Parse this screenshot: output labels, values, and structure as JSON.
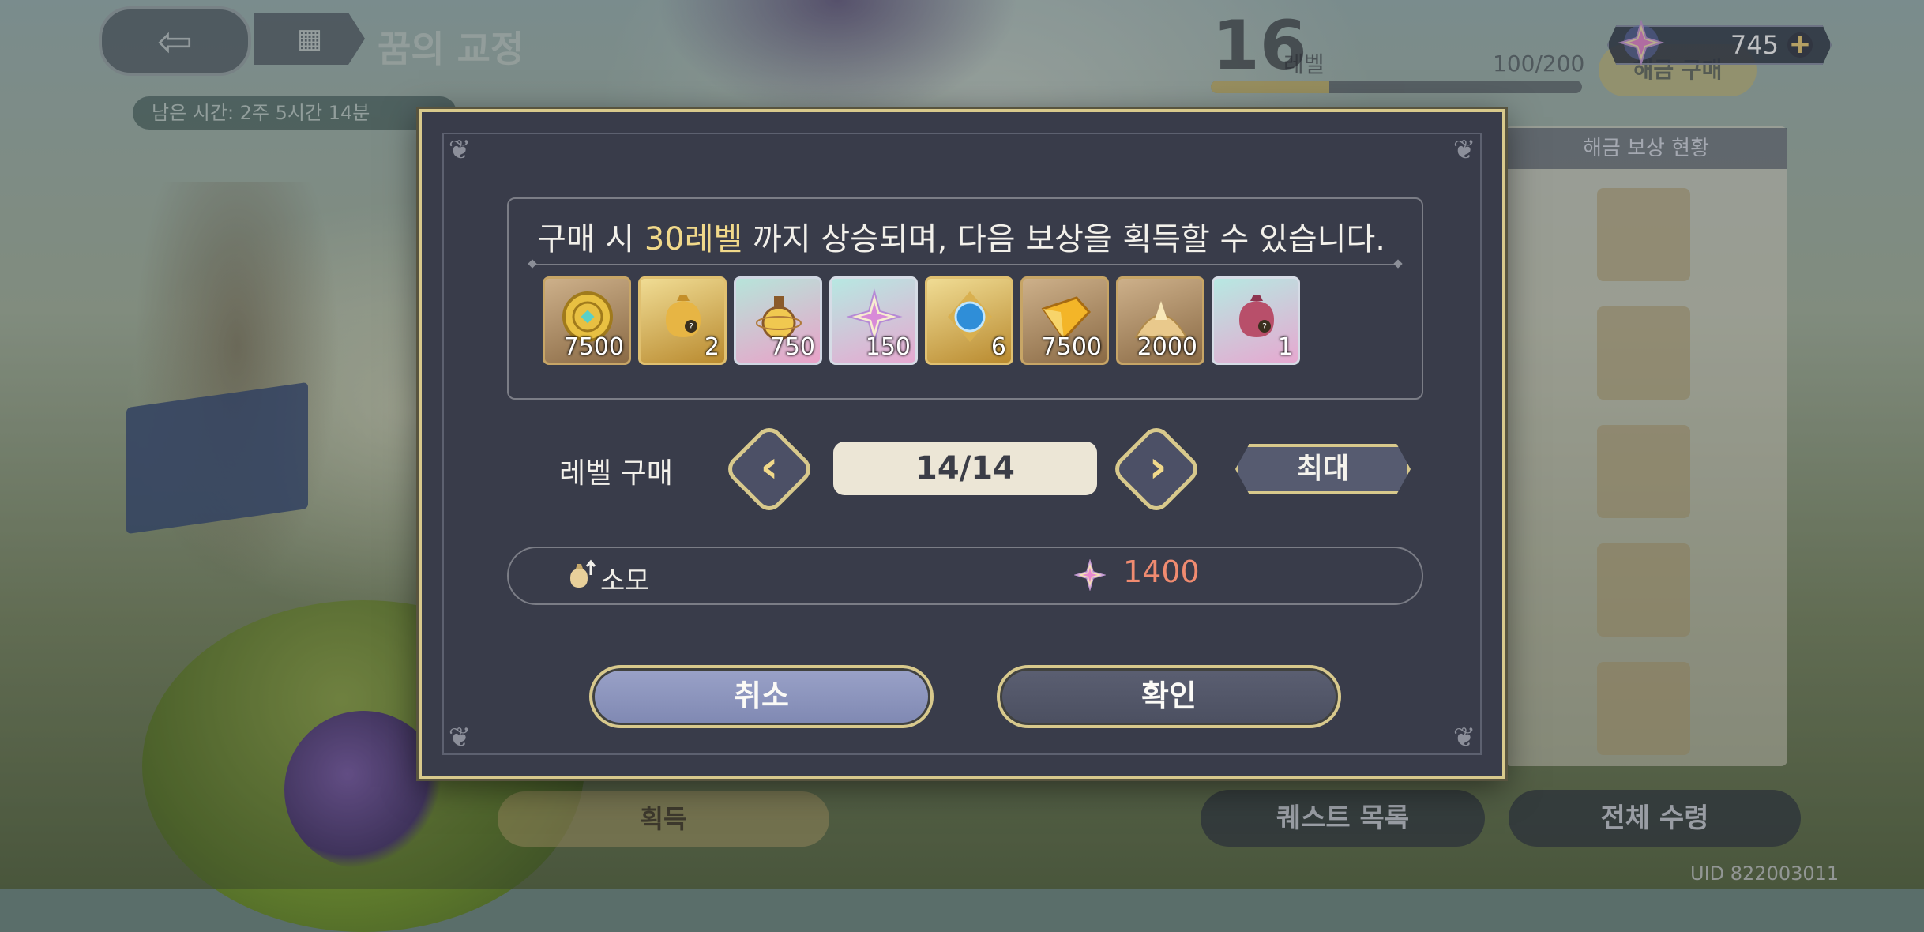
{
  "hud": {
    "screen_title": "꿈의 교정",
    "timer": "남은 시간: 2주  5시간 14분",
    "home_icon": "menu-grid-icon",
    "level": "16",
    "level_unit": "레벨",
    "exp": "100/200",
    "exp_fraction": 0.32,
    "unlock_label": "해금 구매",
    "currency_value": "745",
    "currency_plus": "+"
  },
  "background": {
    "right_panel_header": "해금 보상 현황",
    "quest_list_label": "퀘스트 목록",
    "claim_all_label": "전체 수령",
    "obtain_label": "획득",
    "uid": "UID 822003011"
  },
  "dialog": {
    "desc_before": "구매 시 ",
    "desc_highlight": "30레벨",
    "desc_after": " 까지 상승되며, 다음 보상을 획득할 수 있습니다.",
    "rewards": [
      {
        "name": "gold-coin",
        "count": "7500",
        "frame": "brown"
      },
      {
        "name": "mystery-bag-gold",
        "count": "2",
        "frame": "gold"
      },
      {
        "name": "exp-potion",
        "count": "750",
        "frame": "pink"
      },
      {
        "name": "star-crystal",
        "count": "150",
        "frame": "rainbow"
      },
      {
        "name": "blue-emblem",
        "count": "6",
        "frame": "gold"
      },
      {
        "name": "gold-ingot",
        "count": "7500",
        "frame": "brown"
      },
      {
        "name": "gold-dust-pile",
        "count": "2000",
        "frame": "brown"
      },
      {
        "name": "mystery-bag-pink",
        "count": "1",
        "frame": "rainbow"
      }
    ],
    "level_purchase_label": "레벨 구매",
    "level_value": "14/14",
    "prev_glyph": "‹",
    "next_glyph": "›",
    "max_label": "최대",
    "cost_label": "소모",
    "cost_value": "1400",
    "cancel_label": "취소",
    "confirm_label": "확인",
    "colors": {
      "highlight": "#f1d98a",
      "cost": "#f08b70",
      "frame_gold": "#d8c98c"
    }
  }
}
